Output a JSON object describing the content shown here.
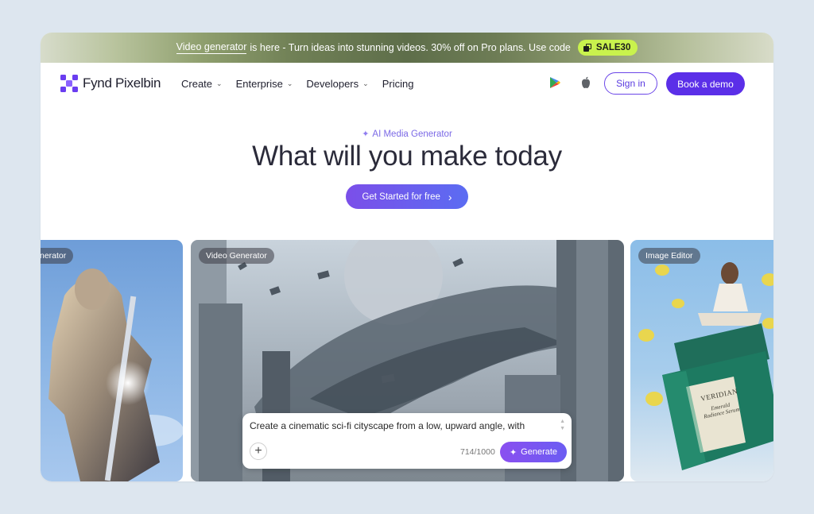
{
  "banner": {
    "link_text": "Video generator",
    "message": "is here - Turn ideas into stunning videos. 30% off on Pro plans. Use code",
    "code": "SALE30",
    "code_icon": "tag-icon"
  },
  "nav": {
    "logo_text": "Fynd Pixelbin",
    "menu": [
      {
        "label": "Create",
        "has_dropdown": true
      },
      {
        "label": "Enterprise",
        "has_dropdown": true
      },
      {
        "label": "Developers",
        "has_dropdown": true
      },
      {
        "label": "Pricing",
        "has_dropdown": false
      }
    ],
    "signin_label": "Sign in",
    "demo_label": "Book a demo",
    "store_icons": [
      "google-play-icon",
      "apple-icon"
    ]
  },
  "hero": {
    "eyebrow": "AI Media Generator",
    "title": "What will you make today",
    "cta_label": "Get Started for free"
  },
  "cards": {
    "left_label": "nerator",
    "mid_label": "Video Generator",
    "right_label": "Image Editor",
    "jar_brand": "VERIDIAN",
    "jar_product": "Emerald Radiance Serum"
  },
  "prompt": {
    "text": "Create a cinematic sci-fi cityscape from a low, upward angle, with",
    "count": "714/1000",
    "generate_label": "Generate"
  },
  "colors": {
    "accent": "#5b2fe8",
    "code_badge": "#c9f24d",
    "page_bg": "#dde6ef"
  }
}
